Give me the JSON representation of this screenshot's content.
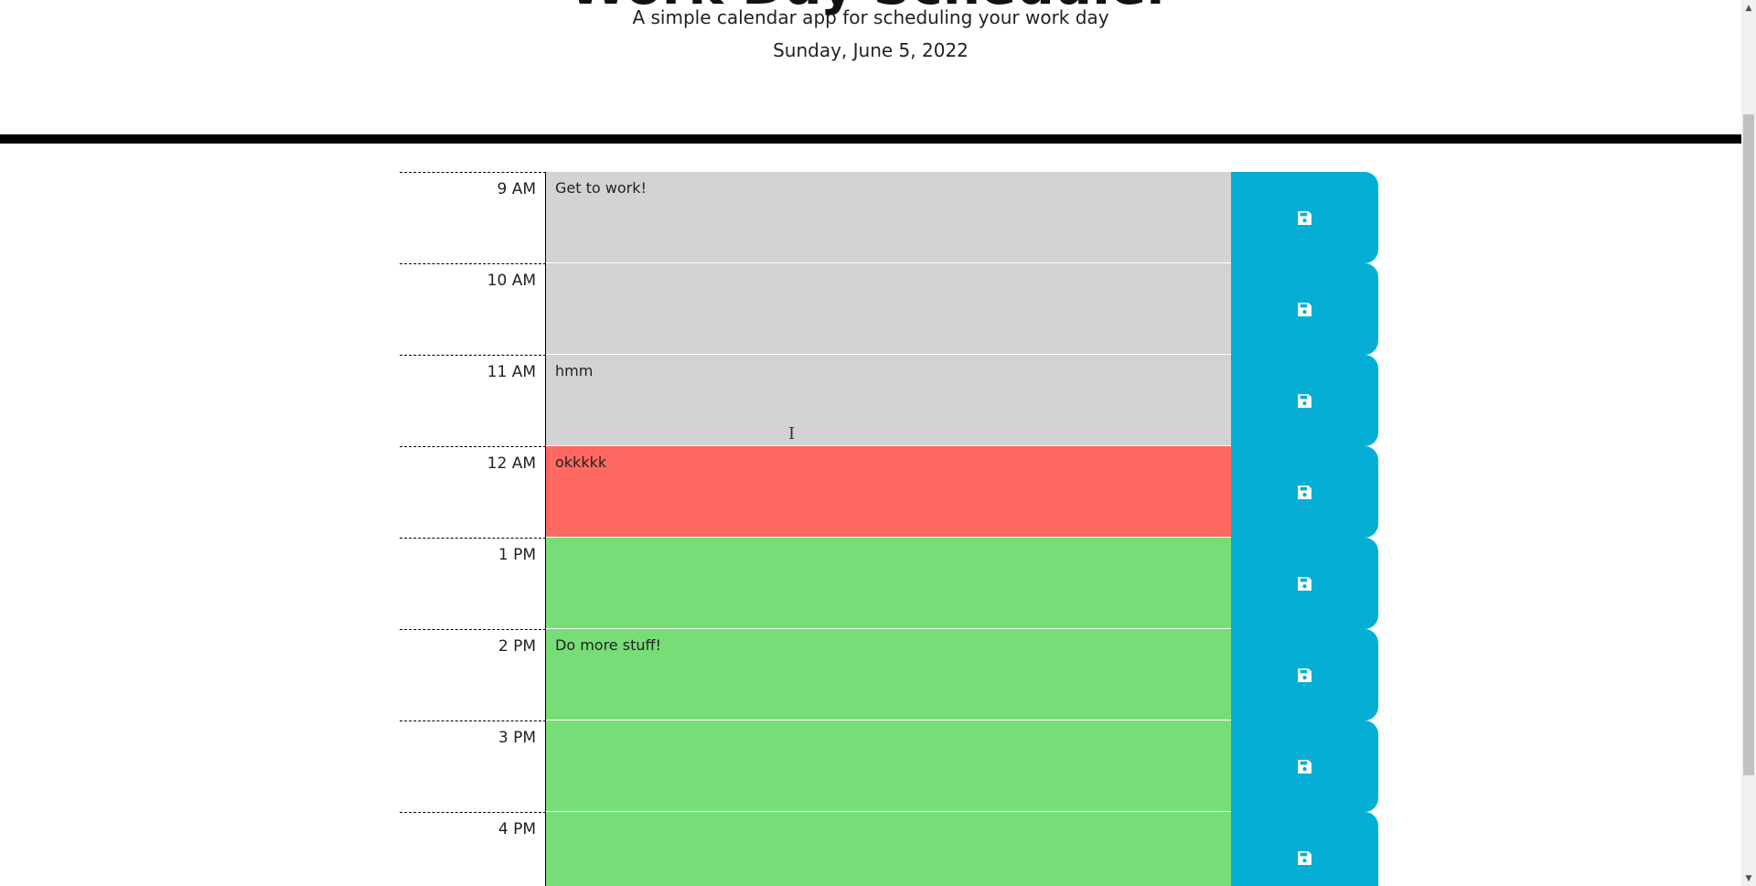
{
  "header": {
    "title": "Work Day Scheduler",
    "subtitle": "A simple calendar app for scheduling your work day",
    "current_day": "Sunday, June 5, 2022"
  },
  "colors": {
    "past": "#d3d3d3",
    "present": "#ff6961",
    "future": "#77dd77",
    "save": "#06aed5"
  },
  "save_icon": "floppy-disk-icon",
  "rows": [
    {
      "hour": "9 AM",
      "text": "Get to work!",
      "state": "past"
    },
    {
      "hour": "10 AM",
      "text": "",
      "state": "past"
    },
    {
      "hour": "11 AM",
      "text": "hmm",
      "state": "past"
    },
    {
      "hour": "12 AM",
      "text": "okkkkk",
      "state": "present"
    },
    {
      "hour": "1 PM",
      "text": "",
      "state": "future"
    },
    {
      "hour": "2 PM",
      "text": "Do more stuff!",
      "state": "future"
    },
    {
      "hour": "3 PM",
      "text": "",
      "state": "future"
    },
    {
      "hour": "4 PM",
      "text": "",
      "state": "future"
    }
  ]
}
